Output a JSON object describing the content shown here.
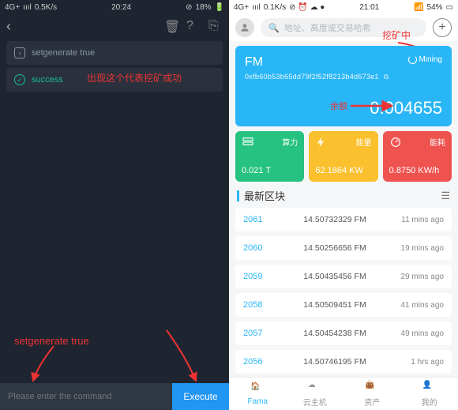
{
  "left": {
    "status": {
      "net": "4G+",
      "signal": "ıııl",
      "speed": "0.5K/s",
      "time": "20:24",
      "battery": "18%",
      "data_off": "⊘"
    },
    "cmd": "setgenerate true",
    "success": "success",
    "note_success": "出现这个代表挖矿成功",
    "note_cmd": "setgenerate true",
    "input_placeholder": "Please enter the command",
    "exec": "Execute"
  },
  "right": {
    "status": {
      "net": "4G+",
      "signal": "ıııl",
      "speed": "0.1K/s",
      "icons": "⊘ ⏰ ☁ ●",
      "time": "21:01",
      "wifi": "54%"
    },
    "search_placeholder": "地址、高度或交易哈希",
    "note_mining": "挖矿中",
    "note_balance": "余额",
    "card": {
      "name": "FM",
      "addr": "0xfb60b53b65dd79f2f52f8213b4d673e1",
      "mining": "Mining",
      "balance": "0.004655"
    },
    "stats": {
      "power": {
        "label": "算力",
        "value": "0.021 T"
      },
      "energy": {
        "label": "能量",
        "value": "62.1864 KW"
      },
      "consume": {
        "label": "能耗",
        "value": "0.8750 KW/h"
      }
    },
    "blocks_title": "最新区块",
    "blocks": [
      {
        "num": "2061",
        "amt": "14.50732329 FM",
        "ago": "11 mins ago"
      },
      {
        "num": "2060",
        "amt": "14.50256656 FM",
        "ago": "19 mins ago"
      },
      {
        "num": "2059",
        "amt": "14.50435456 FM",
        "ago": "29 mins ago"
      },
      {
        "num": "2058",
        "amt": "14.50509451 FM",
        "ago": "41 mins ago"
      },
      {
        "num": "2057",
        "amt": "14.50454238 FM",
        "ago": "49 mins ago"
      },
      {
        "num": "2056",
        "amt": "14.50746195 FM",
        "ago": "1 hrs ago"
      }
    ],
    "tabs": {
      "t1": "Fama",
      "t2": "云主机",
      "t3": "资产",
      "t4": "我的"
    }
  }
}
